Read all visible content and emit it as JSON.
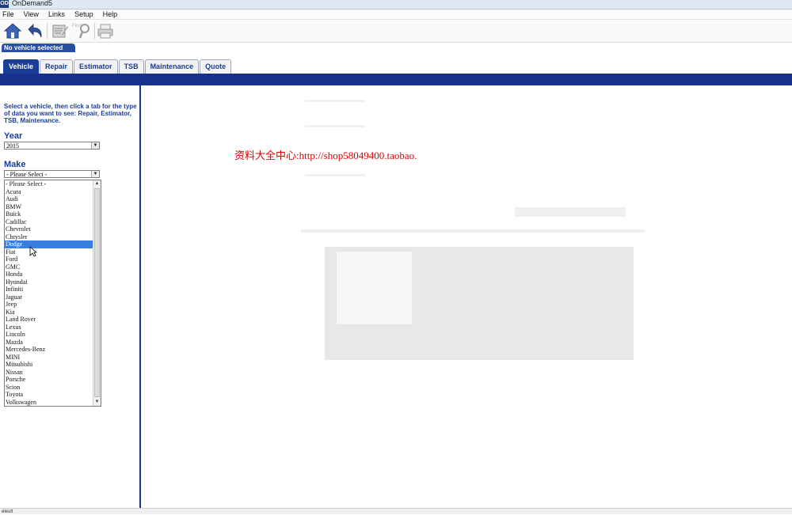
{
  "window": {
    "title": "OnDemand5",
    "app_icon": "OD"
  },
  "menu": [
    "File",
    "View",
    "Links",
    "Setup",
    "Help"
  ],
  "toolbar": {
    "icons": [
      "home-icon",
      "back-icon",
      "notes-icon",
      "find-icon",
      "print-icon"
    ],
    "find_label": "Find"
  },
  "vehicle_status": "No vehicle selected",
  "tabs": [
    {
      "label": "Vehicle",
      "active": true
    },
    {
      "label": "Repair",
      "active": false
    },
    {
      "label": "Estimator",
      "active": false
    },
    {
      "label": "TSB",
      "active": false
    },
    {
      "label": "Maintenance",
      "active": false
    },
    {
      "label": "Quote",
      "active": false
    }
  ],
  "left_panel": {
    "instructions": "Select a vehicle, then click a tab for the type of data you want to see: Repair, Estimator, TSB, Maintenance.",
    "year_label": "Year",
    "year_value": "2015",
    "make_label": "Make",
    "make_value": "- Please Select -",
    "make_options": [
      "- Please Select -",
      "Acura",
      "Audi",
      "BMW",
      "Buick",
      "Cadillac",
      "Chevrolet",
      "Chrysler",
      "Dodge",
      "Fiat",
      "Ford",
      "GMC",
      "Honda",
      "Hyundai",
      "Infiniti",
      "Jaguar",
      "Jeep",
      "Kia",
      "Land Rover",
      "Lexus",
      "Lincoln",
      "Mazda",
      "Mercedes-Benz",
      "MINI",
      "Mitsubishi",
      "Nissan",
      "Porsche",
      "Scion",
      "Toyota",
      "Volkswagen"
    ],
    "highlighted_make": "Dodge"
  },
  "watermark": "资料大全中心:http://shop58049400.taobao.",
  "statusbar": "eleult",
  "colors": {
    "navy": "#18308e",
    "tab_active": "#1a3e98",
    "highlight": "#3a7fe0",
    "watermark": "#e00000"
  }
}
